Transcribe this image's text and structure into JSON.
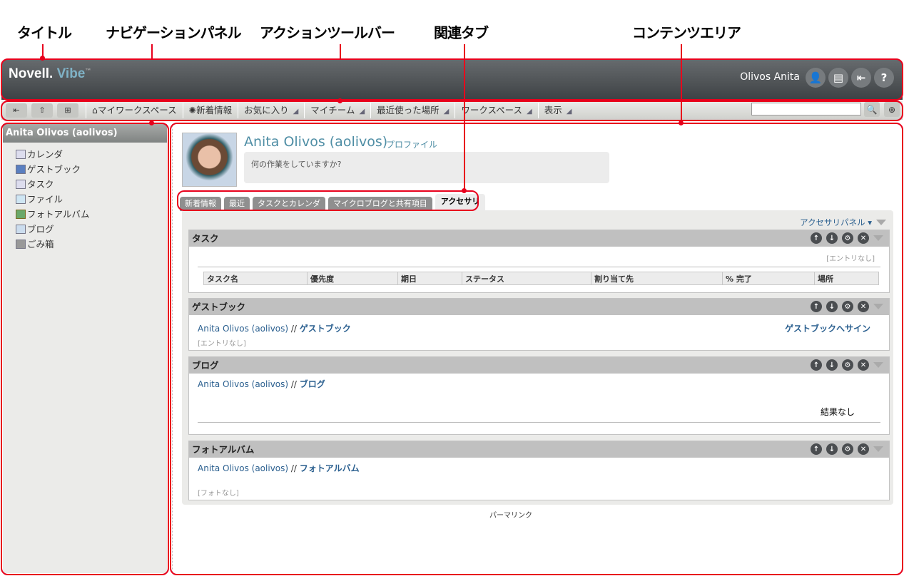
{
  "callouts": {
    "title": "タイトル",
    "nav": "ナビゲーションパネル",
    "toolbar": "アクションツールバー",
    "tabs": "関連タブ",
    "content": "コンテンツエリア"
  },
  "header": {
    "logo_main": "Novell.",
    "logo_sub": "Vibe",
    "logo_tm": "™",
    "user": "Olivos Anita",
    "icons": [
      "user-check-icon",
      "document-icon",
      "logout-icon",
      "help-icon"
    ]
  },
  "toolbar": {
    "items": [
      {
        "label": "マイワークスペース",
        "icon": "home-icon"
      },
      {
        "label": "新着情報",
        "icon": "sun-icon"
      },
      {
        "label": "お気に入り",
        "menu": true
      },
      {
        "label": "マイチーム",
        "menu": true
      },
      {
        "label": "最近使った場所",
        "menu": true
      },
      {
        "label": "ワークスペース",
        "menu": true
      },
      {
        "label": "表示",
        "menu": true
      }
    ],
    "search_value": ""
  },
  "sidebar": {
    "title": "Anita Olivos (aolivos)",
    "items": [
      {
        "label": "カレンダ",
        "icon": "calendar-icon"
      },
      {
        "label": "ゲストブック",
        "icon": "guestbook-icon"
      },
      {
        "label": "タスク",
        "icon": "task-icon"
      },
      {
        "label": "ファイル",
        "icon": "file-icon"
      },
      {
        "label": "フォトアルバム",
        "icon": "photo-album-icon"
      },
      {
        "label": "ブログ",
        "icon": "blog-icon"
      },
      {
        "label": "ごみ箱",
        "icon": "trash-icon"
      }
    ]
  },
  "profile": {
    "name": "Anita Olivos (aolivos)",
    "profile_link": "プロファイル",
    "status_placeholder": "何の作業をしていますか?"
  },
  "tabs": [
    {
      "label": "新着情報"
    },
    {
      "label": "最近"
    },
    {
      "label": "タスクとカレンダ"
    },
    {
      "label": "マイクロブログと共有項目"
    },
    {
      "label": "アクセサリ",
      "active": true
    }
  ],
  "accessory_panel": "アクセサリパネル",
  "sections": {
    "tasks": {
      "title": "タスク",
      "empty": "[エントリなし]",
      "columns": [
        "タスク名",
        "優先度",
        "期日",
        "ステータス",
        "割り当て先",
        "% 完了",
        "場所"
      ]
    },
    "guestbook": {
      "title": "ゲストブック",
      "owner": "Anita Olivos (aolivos)",
      "sep": " // ",
      "name": "ゲストブック",
      "sign": "ゲストブックへサイン",
      "empty": "[エントリなし]"
    },
    "blog": {
      "title": "ブログ",
      "owner": "Anita Olivos (aolivos)",
      "sep": " // ",
      "name": "ブログ",
      "empty": "結果なし"
    },
    "photo": {
      "title": "フォトアルバム",
      "owner": "Anita Olivos (aolivos)",
      "sep": " // ",
      "name": "フォトアルバム",
      "empty": "[フォトなし]"
    }
  },
  "permalink": "パーマリンク",
  "colors": {
    "annotation": "#e8001c",
    "header": "#4a4e51",
    "link": "#2a5f8f"
  }
}
